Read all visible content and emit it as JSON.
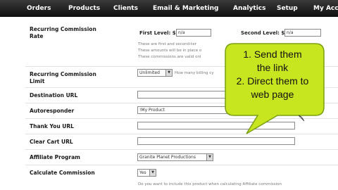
{
  "nav": [
    "Orders",
    "Products",
    "Clients",
    "Email & Marketing",
    "Analytics",
    "Setup",
    "My Acco"
  ],
  "commission": {
    "label_line1": "Recurring Commission",
    "label_line2": "Rate",
    "first_level_label": "First Level: $",
    "first_level_value": "n/a",
    "second_level_label": "Second Level: $",
    "second_level_value": "n/a",
    "note1": "These are first and second-ter",
    "note2": "These amounts will be in place o",
    "note3": "These commissions are valid onl"
  },
  "limit": {
    "label_line1": "Recurring Commission",
    "label_line2": "Limit",
    "select_value": "Unlimited",
    "hint": "How many billing cy"
  },
  "destination": {
    "label": "Destination URL",
    "value": ""
  },
  "autoresponder": {
    "label": "Autoresponder",
    "value": "!My Product"
  },
  "thankyou": {
    "label": "Thank You URL",
    "value": ""
  },
  "clearcart": {
    "label": "Clear Cart URL",
    "value": ""
  },
  "affiliate": {
    "label": "Affiliate Program",
    "value": "Granite Planet Productions"
  },
  "calculate": {
    "label": "Calculate Commission",
    "value": "Yes",
    "footnote": "Do you want to include this product when calculating Affiliate commission"
  },
  "callout": [
    "1. Send them",
    "the link",
    "2. Direct them to",
    "web page"
  ],
  "colors": {
    "nav_bg": "#1e1e1e",
    "callout_fill": "#c8e620",
    "callout_stroke": "#7aa010"
  }
}
